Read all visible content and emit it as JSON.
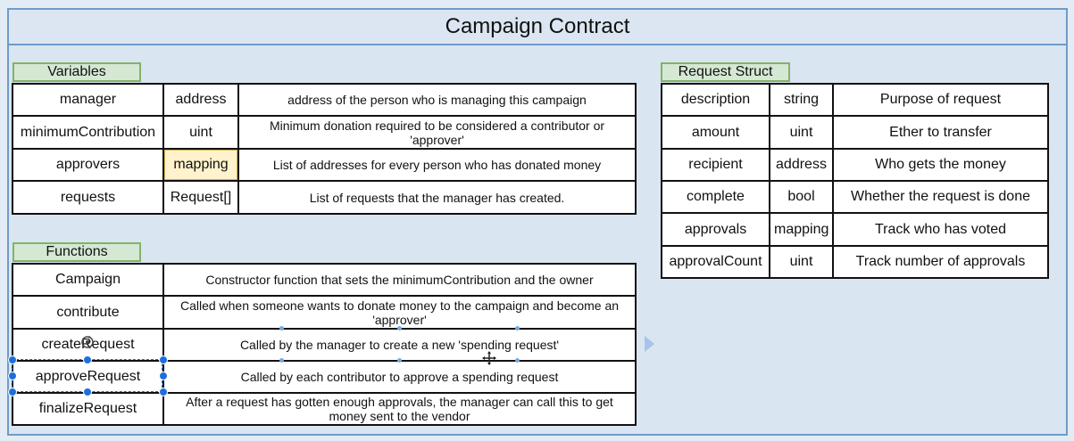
{
  "title": "Campaign Contract",
  "sections": {
    "variables_label": "Variables",
    "functions_label": "Functions",
    "request_struct_label": "Request Struct"
  },
  "variables": [
    {
      "name": "manager",
      "type": "address",
      "description": "address of the person who is managing this campaign"
    },
    {
      "name": "minimumContribution",
      "type": "uint",
      "description": "Minimum donation required to be considered a contributor or 'approver'"
    },
    {
      "name": "approvers",
      "type": "mapping",
      "description": "List of addresses for every person who has donated money"
    },
    {
      "name": "requests",
      "type": "Request[]",
      "description": "List of requests that the manager has created."
    }
  ],
  "functions": [
    {
      "name": "Campaign",
      "description": "Constructor function that sets the minimumContribution and the owner"
    },
    {
      "name": "contribute",
      "description": "Called when someone wants to donate money to the campaign and become an 'approver'"
    },
    {
      "name": "createRequest",
      "description": "Called by the manager to create a new 'spending request'"
    },
    {
      "name": "approveRequest",
      "description": "Called by each contributor to approve a spending request"
    },
    {
      "name": "finalizeRequest",
      "description": "After a request has gotten enough approvals, the manager can call this to get money sent to the vendor"
    }
  ],
  "request_struct": [
    {
      "name": "description",
      "type": "string",
      "description": "Purpose of request"
    },
    {
      "name": "amount",
      "type": "uint",
      "description": "Ether to transfer"
    },
    {
      "name": "recipient",
      "type": "address",
      "description": "Who gets the money"
    },
    {
      "name": "complete",
      "type": "bool",
      "description": "Whether the request is done"
    },
    {
      "name": "approvals",
      "type": "mapping",
      "description": "Track who has voted"
    },
    {
      "name": "approvalCount",
      "type": "uint",
      "description": "Track number of approvals"
    }
  ],
  "colors": {
    "container_fill": "#d9e5f1",
    "container_border": "#6f9bc9",
    "label_fill": "#d5e8d4",
    "label_border": "#82b366",
    "highlight_fill": "#fff2cc",
    "selection": "#1e6fd9"
  },
  "icons": {
    "selection_rotate": "rotate-icon",
    "cursor_move": "move-icon",
    "connector_arrow": "arrow-right-icon"
  }
}
